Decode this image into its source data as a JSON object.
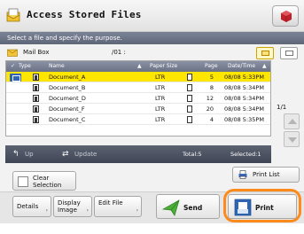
{
  "window": {
    "title": "Access Stored Files"
  },
  "banner": {
    "text": "Select a file and specify the purpose."
  },
  "mailbox": {
    "label": "Mail Box",
    "page": "/01 :"
  },
  "table": {
    "columns": {
      "check": "✓",
      "type": "Type",
      "name": "Name",
      "paper_size": "Paper Size",
      "page": "Page",
      "datetime": "Date/Time"
    },
    "sort_marker_name": "▲",
    "sort_marker_date": "▲",
    "rows": [
      {
        "name": "Document_A",
        "paper": "LTR",
        "page": "5",
        "datetime": "08/08 5:33PM",
        "selected": true
      },
      {
        "name": "Document_B",
        "paper": "LTR",
        "page": "8",
        "datetime": "08/08 5:34PM",
        "selected": false
      },
      {
        "name": "Document_D",
        "paper": "LTR",
        "page": "12",
        "datetime": "08/08 5:34PM",
        "selected": false
      },
      {
        "name": "Document_F",
        "paper": "LTR",
        "page": "20",
        "datetime": "08/08 5:34PM",
        "selected": false
      },
      {
        "name": "Document_C",
        "paper": "LTR",
        "page": "4",
        "datetime": "08/08 5:35PM",
        "selected": false
      }
    ]
  },
  "pager": {
    "text": "1/1"
  },
  "toolbar": {
    "up_label": "Up",
    "update_label": "Update",
    "total_label": "Total:5",
    "selected_label": "Selected:1"
  },
  "actions": {
    "clear_line1": "Clear",
    "clear_line2": "Selection",
    "print_list": "Print List",
    "details": "Details",
    "display_line1": "Display",
    "display_line2": "Image",
    "edit_file": "Edit File",
    "send": "Send",
    "print": "Print"
  },
  "colors": {
    "selected_row": "#ffe600",
    "highlight_ring": "#ff8a1c",
    "header_bar": "#6b7285"
  }
}
